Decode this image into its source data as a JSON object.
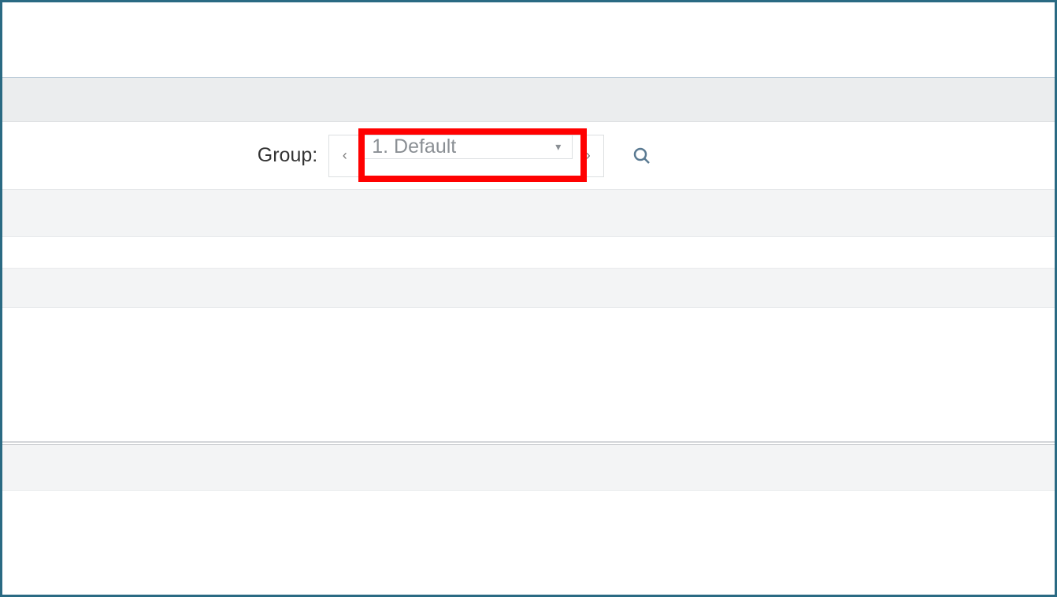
{
  "toolbar": {
    "group_label": "Group:",
    "prev_symbol": "‹",
    "next_symbol": "›",
    "dropdown_value": "1. Default",
    "caret_symbol": "▾"
  },
  "highlight": {
    "target": "group-dropdown"
  }
}
